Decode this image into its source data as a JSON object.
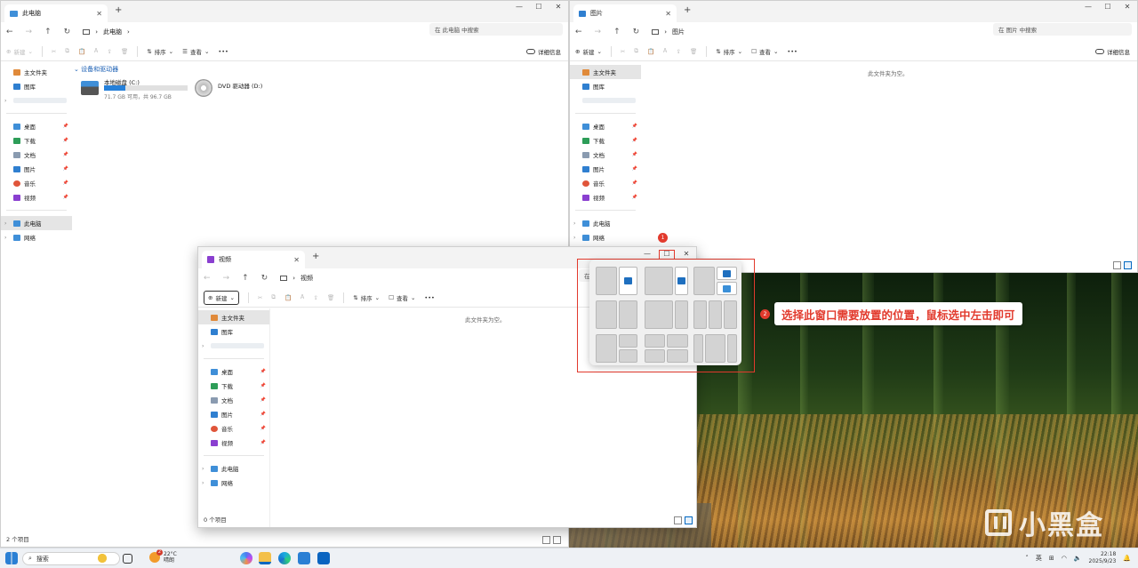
{
  "window_pc": {
    "tab_title": "此电脑",
    "breadcrumb": "此电脑",
    "search_placeholder": "在 此电脑 中搜索",
    "toolbar": {
      "new": "新建",
      "sort": "排序",
      "view": "查看",
      "more": "•••",
      "details": "详细信息"
    },
    "section_header": "设备和驱动器",
    "drives": [
      {
        "name": "本地磁盘 (C:)",
        "info": "71.7 GB 可用，共 96.7 GB",
        "used_fraction": 0.26
      },
      {
        "name": "DVD 驱动器 (D:)",
        "info": ""
      }
    ],
    "status": "2 个项目"
  },
  "window_pictures": {
    "tab_title": "图片",
    "breadcrumb": "图片",
    "search_placeholder": "在 图片 中搜索",
    "empty_text": "此文件夹为空。"
  },
  "window_videos": {
    "tab_title": "视频",
    "breadcrumb": "视频",
    "search_placeholder": "在",
    "empty_text": "此文件夹为空。",
    "status": "0 个项目"
  },
  "sidebar": {
    "home": "主文件夹",
    "gallery": "图库",
    "quick": [
      {
        "label": "桌面",
        "color": "#3f8fd8"
      },
      {
        "label": "下载",
        "color": "#2d9d58"
      },
      {
        "label": "文档",
        "color": "#8a9bb0"
      },
      {
        "label": "图片",
        "color": "#2f7fd0"
      },
      {
        "label": "音乐",
        "color": "#e0553a"
      },
      {
        "label": "视频",
        "color": "#8a3fd0"
      }
    ],
    "this_pc": "此电脑",
    "network": "网络"
  },
  "annotations": {
    "badge1": "1",
    "badge2": "2",
    "callout": "选择此窗口需要放置的位置，鼠标选中左击即可"
  },
  "taskbar": {
    "search": "搜索",
    "weather_temp": "22°C",
    "weather_desc": "晴朗",
    "weather_badge": "2",
    "ime": "英",
    "time": "22:18",
    "date": "2025/9/23"
  },
  "watermark": "小黑盒",
  "colors": {
    "accent": "#0067c0",
    "annotation_red": "#e23a2d"
  }
}
